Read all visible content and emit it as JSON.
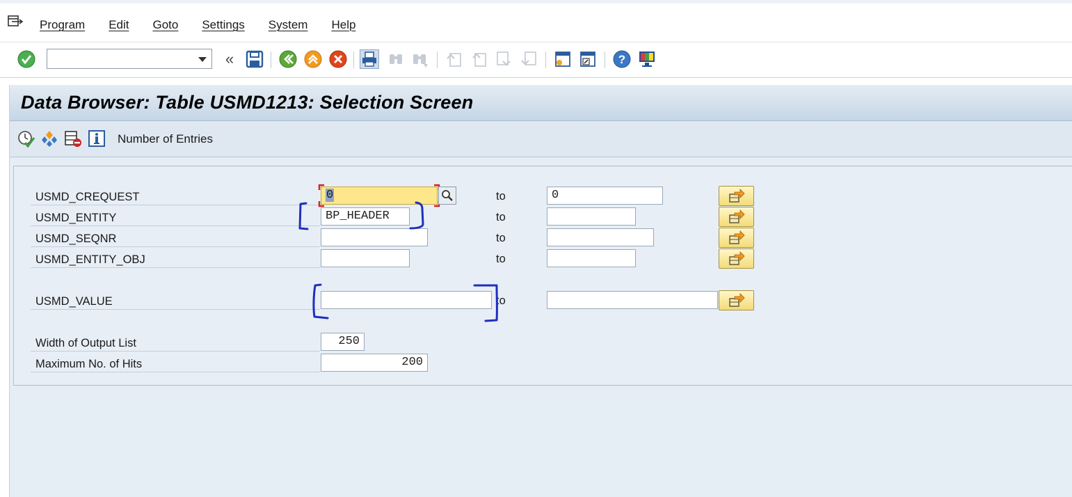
{
  "menu": {
    "items": [
      "Program",
      "Edit",
      "Goto",
      "Settings",
      "System",
      "Help"
    ]
  },
  "toolbar": {
    "command_field_value": "",
    "icons": [
      "enter-icon",
      "save-icon",
      "back-icon",
      "exit-icon",
      "cancel-icon",
      "print-icon",
      "find-icon",
      "find-next-icon",
      "first-page-icon",
      "previous-page-icon",
      "next-page-icon",
      "last-page-icon",
      "create-session-icon",
      "shortcut-icon",
      "help-icon",
      "customize-layout-icon"
    ]
  },
  "title": "Data Browser: Table USMD1213: Selection Screen",
  "app_toolbar": {
    "icons": [
      "execute-icon",
      "selection-options-icon",
      "delete-selection-icon",
      "info-icon"
    ],
    "number_of_entries_label": "Number of Entries"
  },
  "selection": {
    "to_label": "to",
    "rows": [
      {
        "label": "USMD_CREQUEST",
        "low": "0",
        "high": "0"
      },
      {
        "label": "USMD_ENTITY",
        "low": "BP_HEADER",
        "high": ""
      },
      {
        "label": "USMD_SEQNR",
        "low": "",
        "high": ""
      },
      {
        "label": "USMD_ENTITY_OBJ",
        "low": "",
        "high": ""
      },
      {
        "label": "USMD_VALUE",
        "low": "",
        "high": ""
      }
    ],
    "width_label": "Width of Output List",
    "width_value": "250",
    "max_hits_label": "Maximum No. of Hits",
    "max_hits_value": "200"
  },
  "colors": {
    "annotation_blue": "#1f2fbf",
    "focus_field": "#fde78a",
    "focus_corners": "#d42020",
    "enter_green": "#4caf50",
    "exit_orange": "#f29a1e",
    "cancel_red": "#e0451c"
  }
}
